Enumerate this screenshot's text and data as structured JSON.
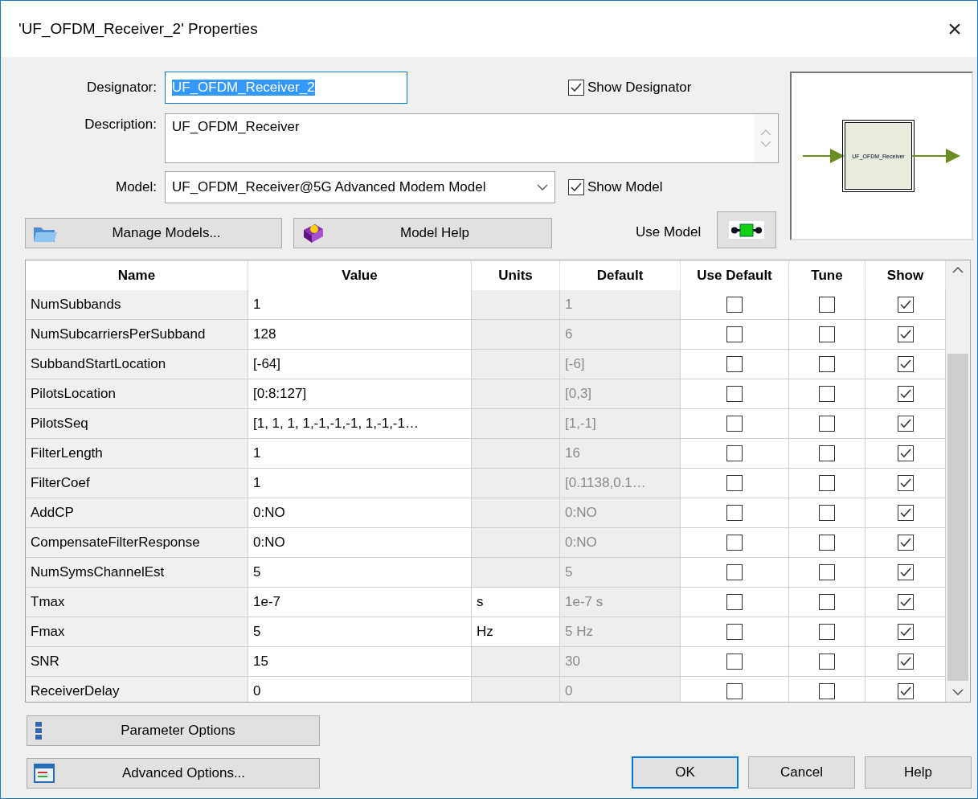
{
  "window": {
    "title": "'UF_OFDM_Receiver_2' Properties",
    "close": "×"
  },
  "designator": {
    "label": "Designator:",
    "value": "UF_OFDM_Receiver_2",
    "text_selected": true
  },
  "show_designator": {
    "label": "Show Designator",
    "checked": true
  },
  "description": {
    "label": "Description:",
    "value": "UF_OFDM_Receiver"
  },
  "model": {
    "label": "Model:",
    "value": "UF_OFDM_Receiver@5G Advanced Modem Model"
  },
  "show_model": {
    "label": "Show Model",
    "checked": true
  },
  "buttons_top": [
    {
      "label": "Manage Models...",
      "kind": "folder"
    },
    {
      "label": "Model Help",
      "kind": "help"
    }
  ],
  "use_model": {
    "label": "Use Model"
  },
  "preview": {
    "block_label": "UF_OFDM_Receiver"
  },
  "table": {
    "columns": [
      "Name",
      "Value",
      "Units",
      "Default",
      "Use Default",
      "Tune",
      "Show"
    ],
    "rows": [
      {
        "name": "NumSubbands",
        "value": "1",
        "units": "",
        "default": "1",
        "use_default": false,
        "tune": false,
        "show": true
      },
      {
        "name": "NumSubcarriersPerSubband",
        "value": "128",
        "units": "",
        "default": "6",
        "use_default": false,
        "tune": false,
        "show": true
      },
      {
        "name": "SubbandStartLocation",
        "value": "[-64]",
        "units": "",
        "default": "[-6]",
        "use_default": false,
        "tune": false,
        "show": true
      },
      {
        "name": "PilotsLocation",
        "value": "[0:8:127]",
        "units": "",
        "default": "[0,3]",
        "use_default": false,
        "tune": false,
        "show": true
      },
      {
        "name": "PilotsSeq",
        "value": "[1, 1, 1, 1,-1,-1,-1, 1,-1,-1…",
        "units": "",
        "default": "[1,-1]",
        "use_default": false,
        "tune": false,
        "show": true
      },
      {
        "name": "FilterLength",
        "value": "1",
        "units": "",
        "default": "16",
        "use_default": false,
        "tune": false,
        "show": true
      },
      {
        "name": "FilterCoef",
        "value": "1",
        "units": "",
        "default": "[0.1138,0.1…",
        "use_default": false,
        "tune": false,
        "show": true
      },
      {
        "name": "AddCP",
        "value": "0:NO",
        "units": "",
        "default": "0:NO",
        "use_default": false,
        "tune": false,
        "show": true
      },
      {
        "name": "CompensateFilterResponse",
        "value": "0:NO",
        "units": "",
        "default": "0:NO",
        "use_default": false,
        "tune": false,
        "show": true
      },
      {
        "name": "NumSymsChannelEst",
        "value": "5",
        "units": "",
        "default": "5",
        "use_default": false,
        "tune": false,
        "show": true
      },
      {
        "name": "Tmax",
        "value": "1e-7",
        "units": "s",
        "default": "1e-7 s",
        "use_default": false,
        "tune": false,
        "show": true
      },
      {
        "name": "Fmax",
        "value": "5",
        "units": "Hz",
        "default": "5 Hz",
        "use_default": false,
        "tune": false,
        "show": true
      },
      {
        "name": "SNR",
        "value": "15",
        "units": "",
        "default": "30",
        "use_default": false,
        "tune": false,
        "show": true
      },
      {
        "name": "ReceiverDelay",
        "value": "0",
        "units": "",
        "default": "0",
        "use_default": false,
        "tune": false,
        "show": true
      }
    ]
  },
  "buttons_left": [
    {
      "label": "Parameter Options",
      "kind": "params"
    },
    {
      "label": "Advanced Options...",
      "kind": "advanced"
    }
  ],
  "buttons_bottom": [
    {
      "label": "OK",
      "default": true
    },
    {
      "label": "Cancel",
      "default": false
    },
    {
      "label": "Help",
      "default": false
    }
  ]
}
